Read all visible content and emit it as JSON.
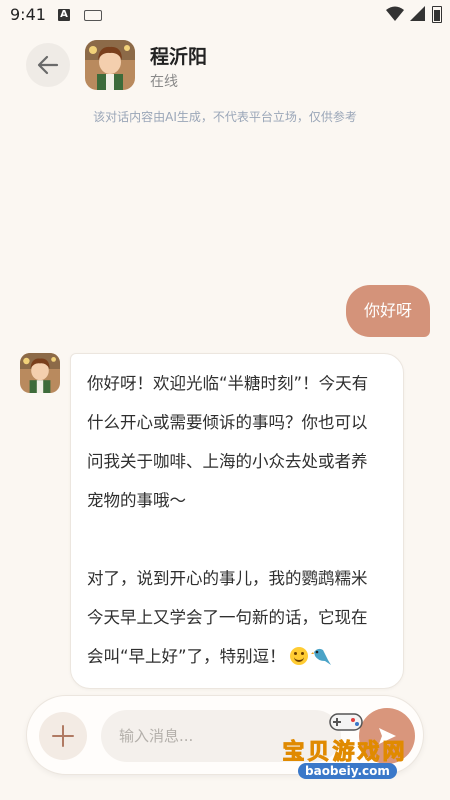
{
  "status_bar": {
    "time": "9:41",
    "a_icon": "A"
  },
  "header": {
    "back_icon": "arrow-left-icon",
    "name": "程沂阳",
    "status": "在线"
  },
  "disclaimer": "该对话内容由AI生成，不代表平台立场，仅供参考",
  "messages": {
    "outgoing": "你好呀",
    "incoming_lines_1": [
      "你好呀！欢迎光临“半糖时刻”！今天有",
      "什么开心或需要倾诉的事吗？你也可以",
      "问我关于咖啡、上海的小众去处或者养",
      "宠物的事哦～"
    ],
    "incoming_lines_2": [
      "对了，说到开心的事儿，我的鹦鹉糯米",
      "今天早上又学会了一句新的话，它现在",
      "会叫“早上好”了，特别逗！"
    ],
    "emojis": [
      "smiling-face-icon",
      "parrot-icon"
    ]
  },
  "composer": {
    "placeholder": "输入消息...",
    "add_icon": "plus-icon",
    "send_icon": "send-icon"
  },
  "watermark": {
    "title": "宝贝游戏网",
    "site": "baobeiy.com"
  },
  "colors": {
    "background": "#fbf7f2",
    "accent": "#d4937a",
    "disclaimer": "#9aa6b8"
  }
}
